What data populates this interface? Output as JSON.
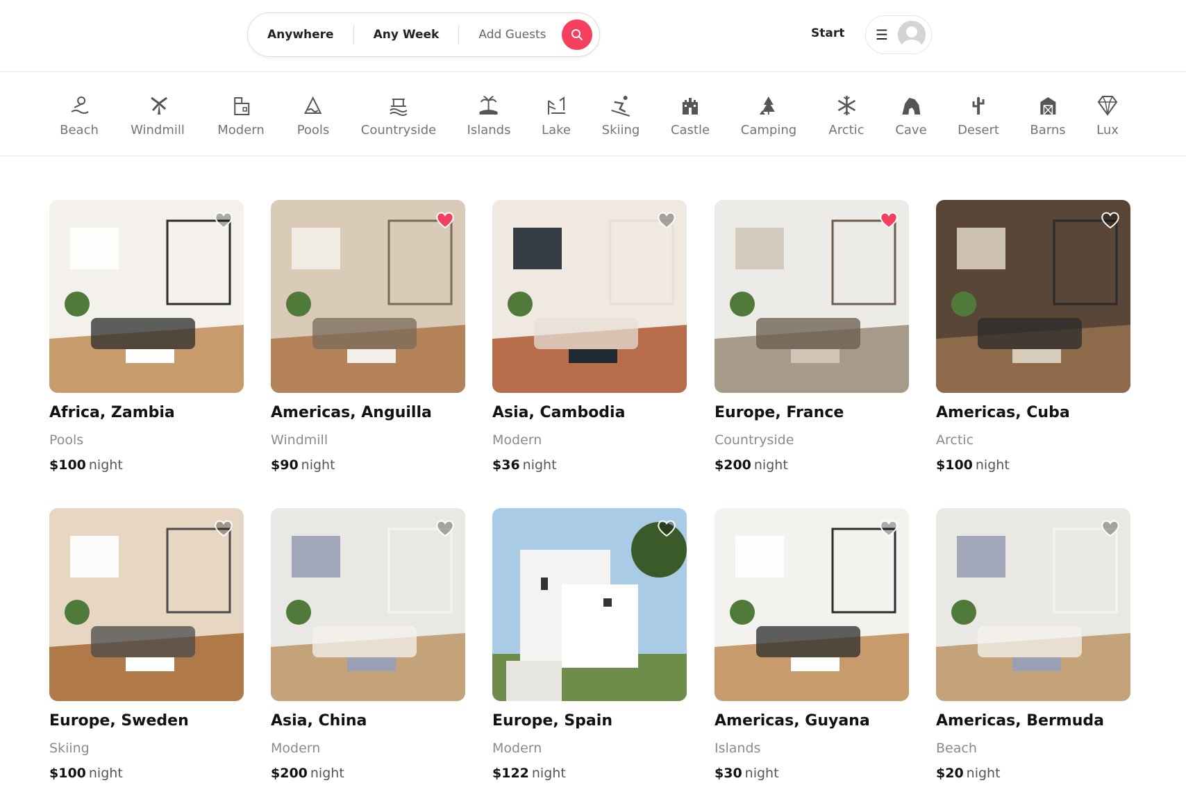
{
  "search": {
    "anywhere": "Anywhere",
    "any_week": "Any Week",
    "add_guests": "Add Guests"
  },
  "nav": {
    "start": "Start"
  },
  "categories": [
    {
      "label": "Beach",
      "icon": "beach-icon"
    },
    {
      "label": "Windmill",
      "icon": "windmill-icon"
    },
    {
      "label": "Modern",
      "icon": "modern-icon"
    },
    {
      "label": "Pools",
      "icon": "pools-icon"
    },
    {
      "label": "Countryside",
      "icon": "countryside-icon"
    },
    {
      "label": "Islands",
      "icon": "islands-icon"
    },
    {
      "label": "Lake",
      "icon": "lake-icon"
    },
    {
      "label": "Skiing",
      "icon": "skiing-icon"
    },
    {
      "label": "Castle",
      "icon": "castle-icon"
    },
    {
      "label": "Camping",
      "icon": "camping-icon"
    },
    {
      "label": "Arctic",
      "icon": "arctic-icon"
    },
    {
      "label": "Cave",
      "icon": "cave-icon"
    },
    {
      "label": "Desert",
      "icon": "desert-icon"
    },
    {
      "label": "Barns",
      "icon": "barns-icon"
    },
    {
      "label": "Lux",
      "icon": "lux-icon"
    }
  ],
  "listings": [
    {
      "title": "Africa, Zambia",
      "category": "Pools",
      "price": "$100",
      "unit": "night",
      "favorited": false
    },
    {
      "title": "Americas, Anguilla",
      "category": "Windmill",
      "price": "$90",
      "unit": "night",
      "favorited": true
    },
    {
      "title": "Asia, Cambodia",
      "category": "Modern",
      "price": "$36",
      "unit": "night",
      "favorited": false
    },
    {
      "title": "Europe, France",
      "category": "Countryside",
      "price": "$200",
      "unit": "night",
      "favorited": true
    },
    {
      "title": "Americas, Cuba",
      "category": "Arctic",
      "price": "$100",
      "unit": "night",
      "favorited": false
    },
    {
      "title": "Europe, Sweden",
      "category": "Skiing",
      "price": "$100",
      "unit": "night",
      "favorited": false
    },
    {
      "title": "Asia, China",
      "category": "Modern",
      "price": "$200",
      "unit": "night",
      "favorited": false
    },
    {
      "title": "Europe, Spain",
      "category": "Modern",
      "price": "$122",
      "unit": "night",
      "favorited": false
    },
    {
      "title": "Americas, Guyana",
      "category": "Islands",
      "price": "$30",
      "unit": "night",
      "favorited": false
    },
    {
      "title": "Americas, Bermuda",
      "category": "Beach",
      "price": "$20",
      "unit": "night",
      "favorited": false
    }
  ],
  "colors": {
    "accent": "#f43f5e",
    "muted_text": "#737373",
    "border": "#dddddd"
  }
}
